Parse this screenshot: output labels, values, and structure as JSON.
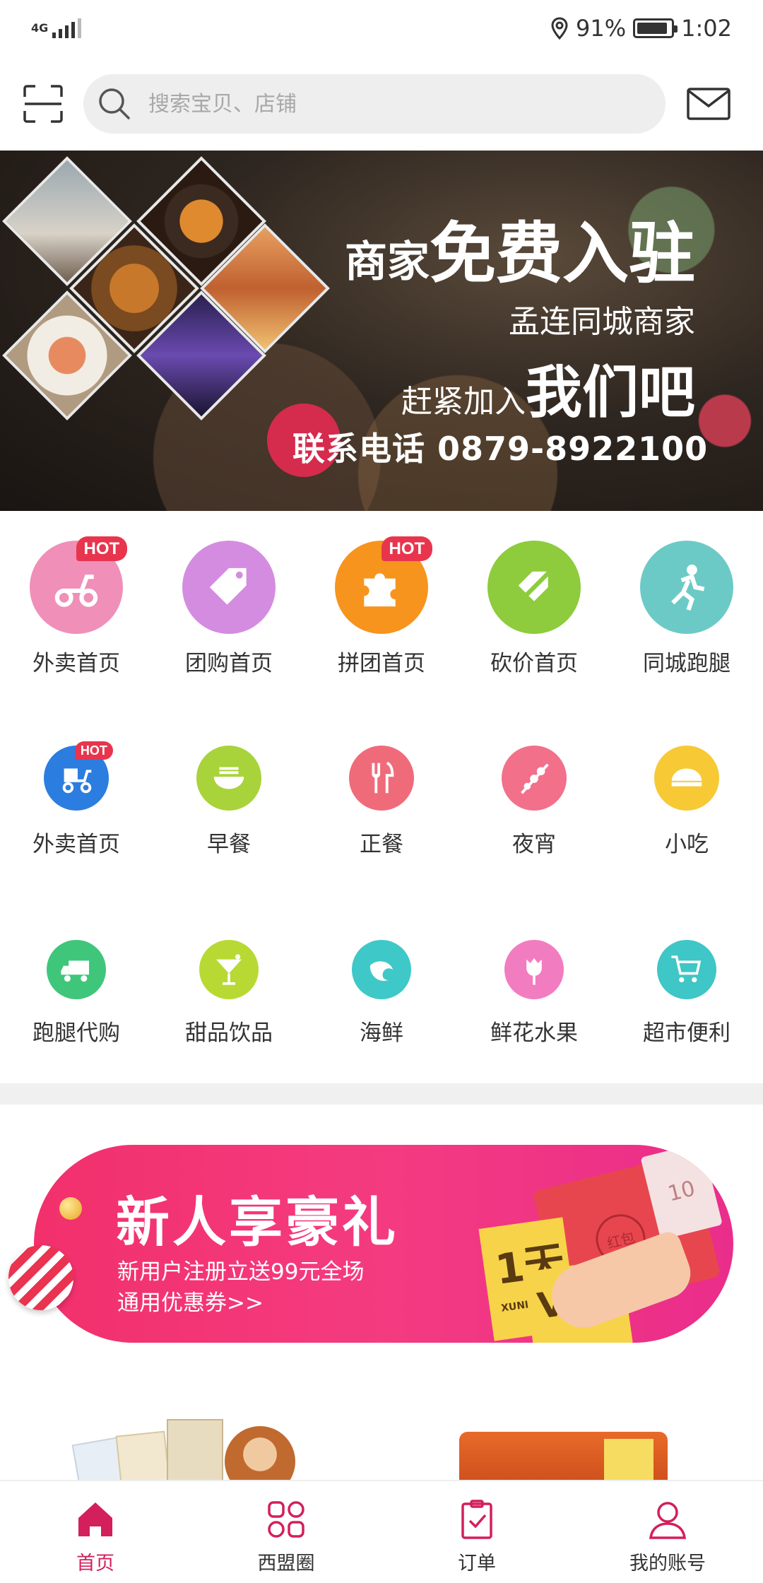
{
  "status_bar": {
    "network": "4G",
    "battery": "91%",
    "time": "1:02",
    "battery_level": 0.91
  },
  "header": {
    "search_placeholder": "搜索宝贝、店铺",
    "scan_icon": "scan-icon",
    "mail_icon": "mail-icon"
  },
  "banner": {
    "line1_small": "商家",
    "line1_big": "免费入驻",
    "line2": "孟连同城商家",
    "line3_small": "赶紧加入",
    "line3_big": "我们吧",
    "phone": "联系电话 0879-8922100"
  },
  "categories_row1": [
    {
      "label": "外卖首页",
      "hot": "HOT",
      "color": "#f08fb8",
      "icon": "scooter-icon"
    },
    {
      "label": "团购首页",
      "hot": "",
      "color": "#d48ce0",
      "icon": "tag-icon"
    },
    {
      "label": "拼团首页",
      "hot": "HOT",
      "color": "#f7941d",
      "icon": "puzzle-icon"
    },
    {
      "label": "砍价首页",
      "hot": "",
      "color": "#8ecb3d",
      "icon": "price-cut-icon"
    },
    {
      "label": "同城跑腿",
      "hot": "",
      "color": "#6ccac6",
      "icon": "runner-icon"
    }
  ],
  "categories_row2": [
    {
      "label": "外卖首页",
      "hot": "HOT",
      "color": "#2b7de0",
      "icon": "delivery-scooter-icon"
    },
    {
      "label": "早餐",
      "hot": "",
      "color": "#a8d33a",
      "icon": "noodle-bowl-icon"
    },
    {
      "label": "正餐",
      "hot": "",
      "color": "#f06b7a",
      "icon": "fork-knife-icon"
    },
    {
      "label": "夜宵",
      "hot": "",
      "color": "#f2708a",
      "icon": "skewer-icon"
    },
    {
      "label": "小吃",
      "hot": "",
      "color": "#f7c934",
      "icon": "dumpling-icon"
    }
  ],
  "categories_row3": [
    {
      "label": "跑腿代购",
      "hot": "",
      "color": "#3fc67b",
      "icon": "truck-icon"
    },
    {
      "label": "甜品饮品",
      "hot": "",
      "color": "#b8d933",
      "icon": "cocktail-icon"
    },
    {
      "label": "海鲜",
      "hot": "",
      "color": "#3fc8c8",
      "icon": "shrimp-icon"
    },
    {
      "label": "鲜花水果",
      "hot": "",
      "color": "#f27cc0",
      "icon": "rose-icon"
    },
    {
      "label": "超市便利",
      "hot": "",
      "color": "#3fc6c6",
      "icon": "cart-icon"
    }
  ],
  "promo": {
    "title": "新人享豪礼",
    "sub1": "新用户注册立送99元全场",
    "sub2": "通用优惠券>>",
    "ticket1": "1天",
    "ticket2": "VIP",
    "ticket_brand": "XUNLEI",
    "envelope_text": "红包",
    "note_text": "10"
  },
  "bottom_nav": [
    {
      "label": "首页",
      "icon": "home-icon",
      "active": true
    },
    {
      "label": "西盟圈",
      "icon": "grid-icon",
      "active": false
    },
    {
      "label": "订单",
      "icon": "clipboard-icon",
      "active": false
    },
    {
      "label": "我的账号",
      "icon": "user-icon",
      "active": false
    }
  ],
  "colors": {
    "accent": "#d31f5c",
    "hot_badge": "#e8354d",
    "promo": "#f2306c"
  }
}
